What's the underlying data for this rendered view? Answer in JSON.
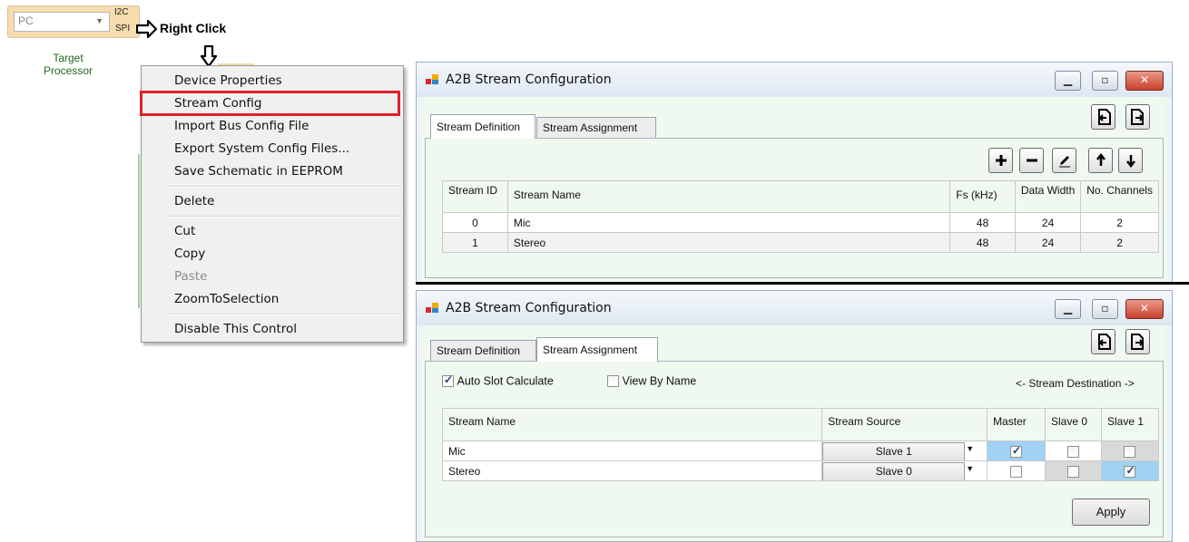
{
  "processor": {
    "combo_value": "PC",
    "ports": [
      "I2C",
      "SPI"
    ],
    "label": "Target\nProcessor",
    "callout": "Right Click"
  },
  "context_menu": {
    "items": [
      {
        "label": "Device Properties"
      },
      {
        "label": "Stream Config",
        "highlighted": true
      },
      {
        "label": "Import Bus Config File"
      },
      {
        "label": "Export System Config Files..."
      },
      {
        "label": "Save Schematic in EEPROM"
      },
      {
        "label": "Delete"
      },
      {
        "label": "Cut"
      },
      {
        "label": "Copy"
      },
      {
        "label": "Paste",
        "disabled": true
      },
      {
        "label": "ZoomToSelection"
      },
      {
        "label": "Disable This Control"
      }
    ],
    "highlight_color": "#e0202a"
  },
  "win_def": {
    "title": "A2B Stream Configuration",
    "tabs": [
      {
        "label": "Stream Definition",
        "active": true
      },
      {
        "label": "Stream Assignment",
        "active": false
      }
    ],
    "toolbar": [
      "plus-icon",
      "minus-icon",
      "edit-icon",
      "arrow-up-icon",
      "arrow-down-icon"
    ],
    "columns": [
      "Stream ID",
      "Stream Name",
      "Fs (kHz)",
      "Data Width",
      "No. Channels"
    ],
    "rows": [
      {
        "id": "0",
        "name": "Mic",
        "fs": "48",
        "width": "24",
        "channels": "2"
      },
      {
        "id": "1",
        "name": "Stereo",
        "fs": "48",
        "width": "24",
        "channels": "2"
      }
    ]
  },
  "win_asg": {
    "title": "A2B Stream Configuration",
    "tabs": [
      {
        "label": "Stream Definition",
        "active": false
      },
      {
        "label": "Stream Assignment",
        "active": true
      }
    ],
    "auto_slot": {
      "label": "Auto Slot Calculate",
      "checked": true
    },
    "view_by_name": {
      "label": "View By Name",
      "checked": false
    },
    "destination_label": "<- Stream Destination ->",
    "columns": [
      "Stream Name",
      "Stream Source",
      "Master",
      "Slave 0",
      "Slave 1"
    ],
    "rows": [
      {
        "name": "Mic",
        "source": "Slave 1",
        "master": true,
        "slave0": false,
        "slave1": false
      },
      {
        "name": "Stereo",
        "source": "Slave 0",
        "master": false,
        "slave0": false,
        "slave1": true
      }
    ],
    "apply_label": "Apply"
  },
  "colors": {
    "title_accent": "#1c62b9",
    "selected_cell": "#9fd2f4",
    "disabled_cell": "#d9d9d9"
  }
}
